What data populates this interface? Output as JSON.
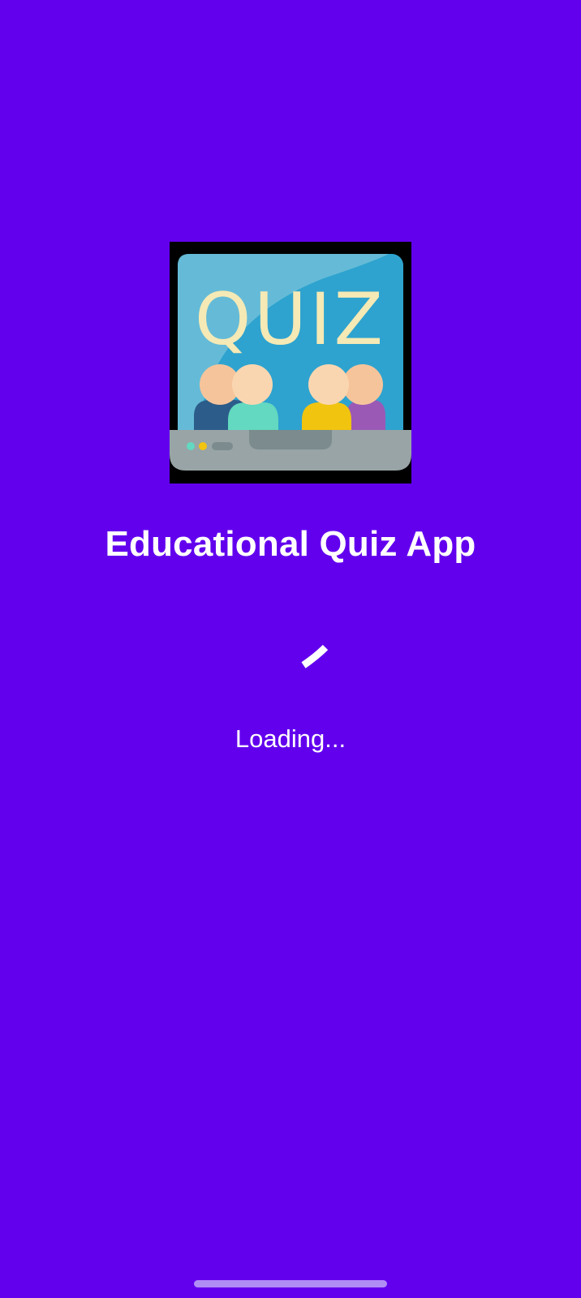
{
  "app": {
    "title": "Educational Quiz App",
    "loading_text": "Loading..."
  },
  "logo": {
    "icon": "quiz-laptop-icon",
    "text": "QUIZ"
  },
  "colors": {
    "background": "#6200EE",
    "text": "#FFFFFF",
    "nav_handle": "#B08CF5"
  },
  "progress": {
    "indeterminate": true
  }
}
